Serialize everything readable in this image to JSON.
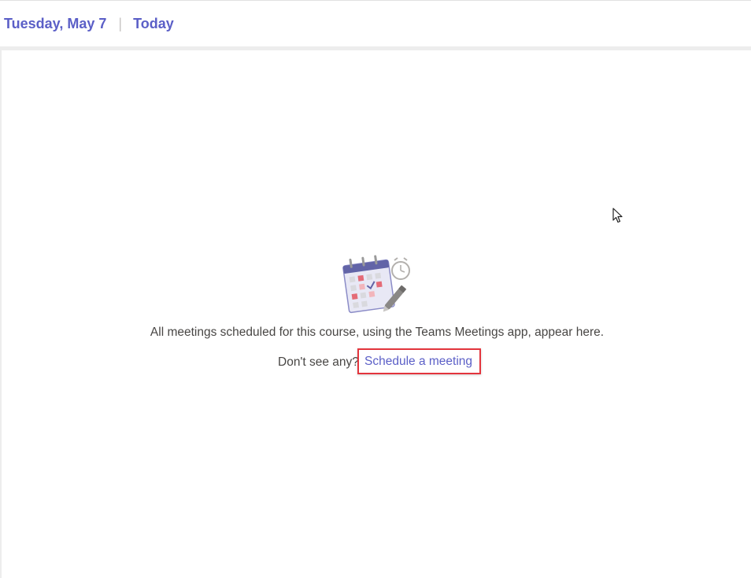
{
  "header": {
    "date": "Tuesday, May 7",
    "separator": "|",
    "today_label": "Today"
  },
  "empty_state": {
    "illustration_icon": "calendar-clock-pen-icon",
    "message": "All meetings scheduled for this course, using the Teams Meetings app, appear here.",
    "prompt": "Don't see any?",
    "link_label": "Schedule a meeting"
  },
  "colors": {
    "accent": "#5b5fc7",
    "text": "#484644",
    "highlight_box": "#e3353d"
  },
  "cursor_icon": "mouse-pointer-icon"
}
